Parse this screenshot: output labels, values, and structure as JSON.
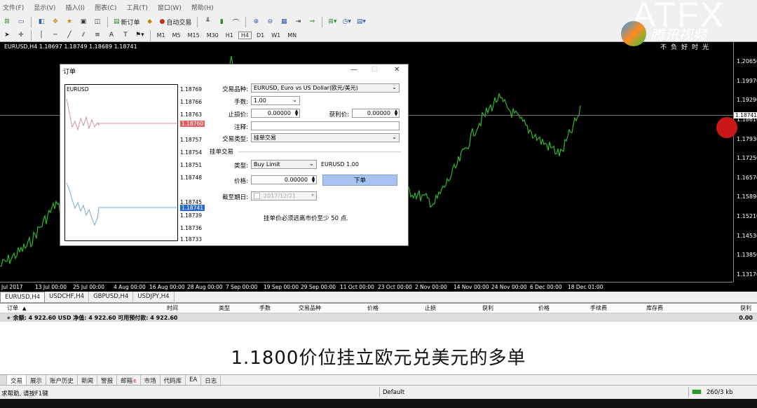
{
  "menu": [
    "文件(F)",
    "显示(V)",
    "插入(I)",
    "图表(C)",
    "工具(T)",
    "窗口(W)",
    "帮助(H)"
  ],
  "toolbar": {
    "new_order": "新订单",
    "auto_trade": "自动交易",
    "timeframes": [
      "M1",
      "M5",
      "M15",
      "M30",
      "H1",
      "H4",
      "D1",
      "W1",
      "MN"
    ]
  },
  "watermark": {
    "brand": "ATFX",
    "video_brand": "腾讯视频",
    "slogan": "不负好时光"
  },
  "chart": {
    "title": "EURUSD,H4  1.18697 1.18749 1.18689 1.18741",
    "y_ticks": [
      "1.20650",
      "1.19970",
      "1.19290",
      "1.18610",
      "1.17930",
      "1.17250",
      "1.16570",
      "1.15890",
      "1.15210",
      "1.14530",
      "1.13850",
      "1.13170"
    ],
    "current_price": "1.18741",
    "x_ticks": [
      "Jul 2017",
      "13 Jul 00:00",
      "25 Jul 00:00",
      "4 Aug 00:00",
      "16 Aug 00:00",
      "28 Aug 00:00",
      "7 Sep 00:00",
      "19 Sep 00:00",
      "29 Sep 00:00",
      "11 Oct 00:00",
      "23 Oct 00:00",
      "2 Nov 00:00",
      "14 Nov 00:00",
      "24 Nov 00:00",
      "6 Dec 00:00",
      "18 Dec 01:00"
    ],
    "series_color": "#2fb52f"
  },
  "chart_tabs": [
    "EURUSD,H4",
    "USDCHF,H4",
    "GBPUSD,H4",
    "USDJPY,H4"
  ],
  "terminal": {
    "headers": [
      "订单",
      "时间",
      "类型",
      "手数",
      "交易品种",
      "价格",
      "止损",
      "获利",
      "价格",
      "手续费",
      "库存费",
      "获利"
    ],
    "balance_text": "余额: 4 922.60 USD  净值: 4 922.60  可用预付款: 4 922.60",
    "balance_profit": "0.00"
  },
  "caption": "1.1800价位挂立欧元兑美元的多单",
  "bottom_tabs": [
    "交易",
    "展示",
    "账户历史",
    "新闻",
    "警报",
    "邮箱",
    "市场",
    "代码库",
    "EA",
    "日志"
  ],
  "mail_count": "6",
  "status": {
    "help": "求帮助, 请按F1键",
    "profile": "Default",
    "traffic": "260/3 kb"
  },
  "dialog": {
    "title": "订单",
    "mini_title": "EURUSD",
    "mini_ticks": [
      "1.18769",
      "1.18766",
      "1.18763",
      "1.18760",
      "1.18757",
      "1.18754",
      "1.18751",
      "1.18748",
      "1.18745",
      "1.18742",
      "1.18739",
      "1.18736",
      "1.18733"
    ],
    "bid": "1.18760",
    "ask": "1.18741",
    "symbol_label": "交易品种:",
    "symbol_value": "EURUSD, Euro vs US Dollar(欧元/美元)",
    "volume_label": "手数:",
    "volume_value": "1.00",
    "sl_label": "止损价:",
    "sl_value": "0.00000",
    "tp_label": "获利价:",
    "tp_value": "0.00000",
    "comment_label": "注释:",
    "comment_value": "",
    "type_label": "交易类型:",
    "type_value": "挂单交易",
    "pending_section": "挂单交易",
    "ptype_label": "类型:",
    "ptype_value": "Buy Limit",
    "ptype_info": "EURUSD 1.00",
    "price_label": "价格:",
    "price_value": "0.00000",
    "order_button": "下单",
    "expiry_label": "截至期日:",
    "expiry_value": "2017/12/21",
    "note": "挂单价必须远离市价至少 50 点."
  }
}
